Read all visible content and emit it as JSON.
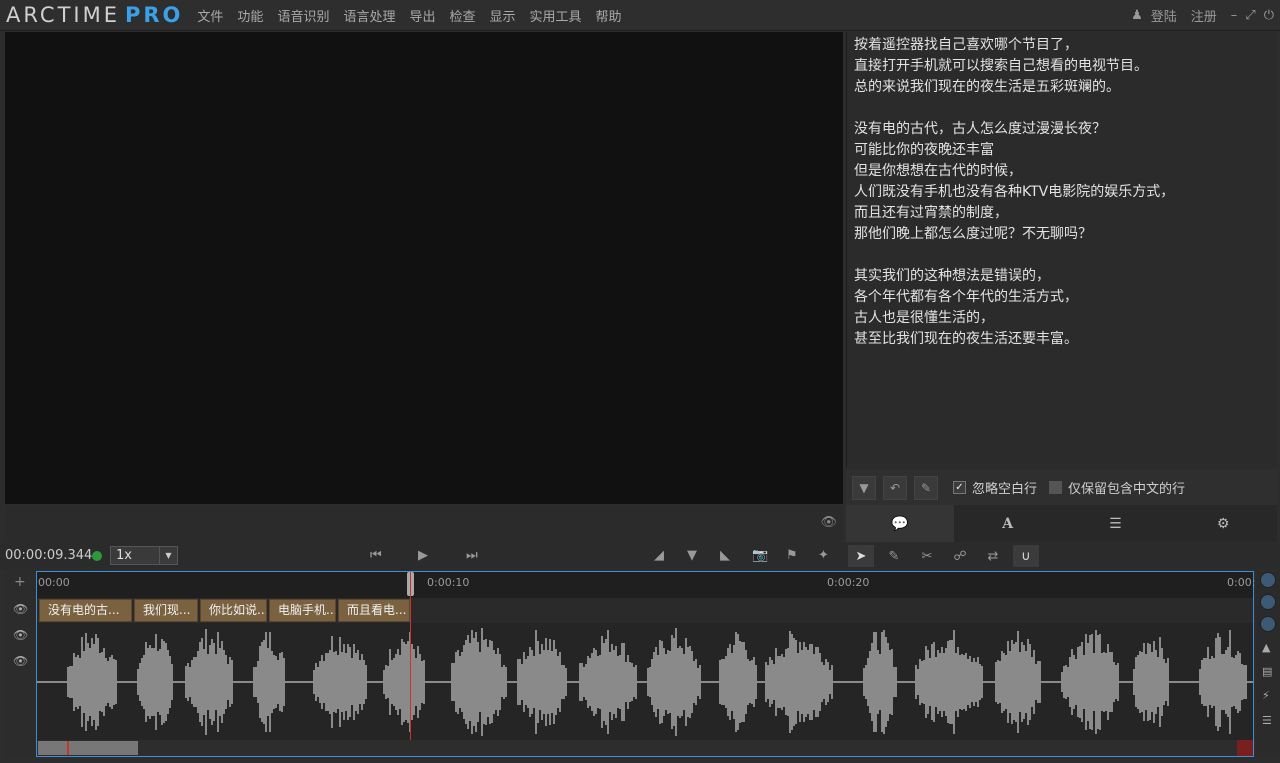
{
  "app": {
    "logo_main": "ARCTIME",
    "logo_pro": "PRO",
    "menu": [
      "文件",
      "功能",
      "语音识别",
      "语言处理",
      "导出",
      "检查",
      "显示",
      "实用工具",
      "帮助"
    ],
    "login": "登陆",
    "register": "注册"
  },
  "text_panel": {
    "lines": [
      "按着遥控器找自己喜欢哪个节目了，",
      "直接打开手机就可以搜索自己想看的电视节目。",
      "总的来说我们现在的夜生活是五彩斑斓的。",
      "",
      "没有电的古代，古人怎么度过漫漫长夜？",
      "可能比你的夜晚还丰富",
      "但是你想想在古代的时候，",
      "人们既没有手机也没有各种KTV电影院的娱乐方式，",
      "而且还有过宵禁的制度，",
      "那他们晚上都怎么度过呢？不无聊吗？",
      "",
      "其实我们的这种想法是错误的，",
      "各个年代都有各个年代的生活方式，",
      "古人也是很懂生活的，",
      "甚至比我们现在的夜生活还要丰富。"
    ],
    "ignore_blank_label": "忽略空白行",
    "keep_chinese_label": "仅保留包含中文的行"
  },
  "transport": {
    "timecode": "00:00:09.344",
    "speed": "1x"
  },
  "timeline": {
    "ruler_labels": [
      "00:00",
      "0:00:10",
      "0:00:20",
      "0:00:"
    ],
    "subtitles": [
      "没有电的古...",
      "我们现...",
      "你比如说...",
      "电脑手机...",
      "而且看电..."
    ]
  }
}
